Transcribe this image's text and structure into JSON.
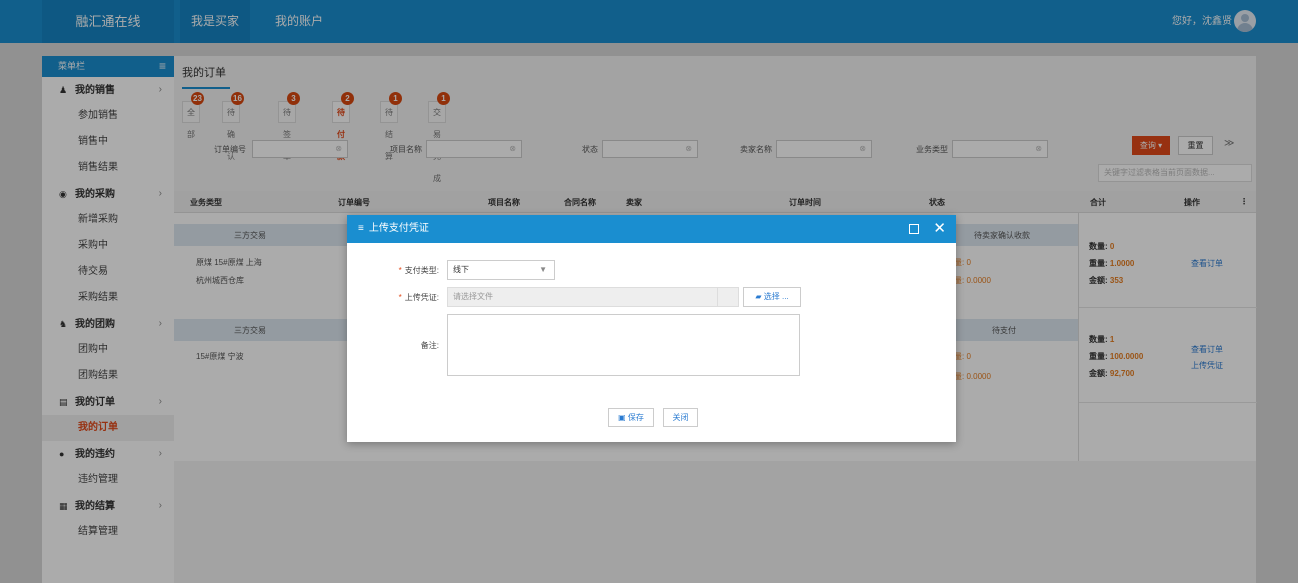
{
  "topbar": {
    "brand": "融汇通在线",
    "nav": [
      "我是买家",
      "我的账户"
    ],
    "greeting": "您好，沈鑫贤"
  },
  "sidebar": {
    "header": "菜单栏",
    "groups": [
      {
        "label": "我的销售",
        "icon": "person-up-icon",
        "items": [
          "参加销售",
          "销售中",
          "销售结果"
        ]
      },
      {
        "label": "我的采购",
        "icon": "search-circle-icon",
        "items": [
          "新增采购",
          "采购中",
          "待交易",
          "采购结果"
        ]
      },
      {
        "label": "我的团购",
        "icon": "people-icon",
        "items": [
          "团购中",
          "团购结果"
        ]
      },
      {
        "label": "我的订单",
        "icon": "document-icon",
        "items": [
          "我的订单"
        ]
      },
      {
        "label": "我的违约",
        "icon": "alert-circle-icon",
        "items": [
          "违约管理"
        ]
      },
      {
        "label": "我的结算",
        "icon": "calculator-icon",
        "items": [
          "结算管理"
        ]
      }
    ],
    "active_item": "我的订单"
  },
  "main": {
    "title": "我的订单",
    "tabs": [
      {
        "label": "全部",
        "badge": "23"
      },
      {
        "label": "待确认",
        "badge": "16"
      },
      {
        "label": "待签章",
        "badge": "3"
      },
      {
        "label": "待付款",
        "badge": "2"
      },
      {
        "label": "待结算",
        "badge": "1"
      },
      {
        "label": "交易完成",
        "badge": "1"
      }
    ],
    "filters": [
      "订单编号",
      "项目名称",
      "状态",
      "卖家名称",
      "业务类型"
    ],
    "query_btn": "查询",
    "reset_btn": "重置",
    "keyword_placeholder": "关键字过滤表格当前页面数据...",
    "columns": [
      "业务类型",
      "订单编号",
      "项目名称",
      "合同名称",
      "卖家",
      "订单时间",
      "状态",
      "合计",
      "操作"
    ],
    "rows": [
      {
        "type": "三方交易",
        "desc1": "原煤 15#原煤 上海",
        "desc2": "杭州城西仓库",
        "status": "待卖家确认收款",
        "q1": "量: 0",
        "q2": "量: 0.0000",
        "sum_qty_label": "数量:",
        "sum_qty": "0",
        "sum_wt_label": "重量:",
        "sum_wt": "1.0000",
        "sum_amt_label": "金额:",
        "sum_amt": "353",
        "actions": [
          "查看订单"
        ]
      },
      {
        "type": "三方交易",
        "desc1": "15#原煤 宁波",
        "desc2": "",
        "status": "待支付",
        "q1": "量: 0",
        "q2": "量: 0.0000",
        "sum_qty_label": "数量:",
        "sum_qty": "1",
        "sum_wt_label": "重量:",
        "sum_wt": "100.0000",
        "sum_amt_label": "金额:",
        "sum_amt": "92,700",
        "actions": [
          "查看订单",
          "上传凭证"
        ]
      }
    ]
  },
  "modal": {
    "title": "上传支付凭证",
    "pay_type_label": "支付类型:",
    "pay_type_value": "线下",
    "voucher_label": "上传凭证:",
    "voucher_placeholder": "请选择文件",
    "choose_btn": "选择 ...",
    "note_label": "备注:",
    "save_btn": "保存",
    "close_btn": "关闭"
  },
  "colors": {
    "primary": "#1a8ed0",
    "accent": "#e24a1a",
    "badge": "#d9480f"
  }
}
